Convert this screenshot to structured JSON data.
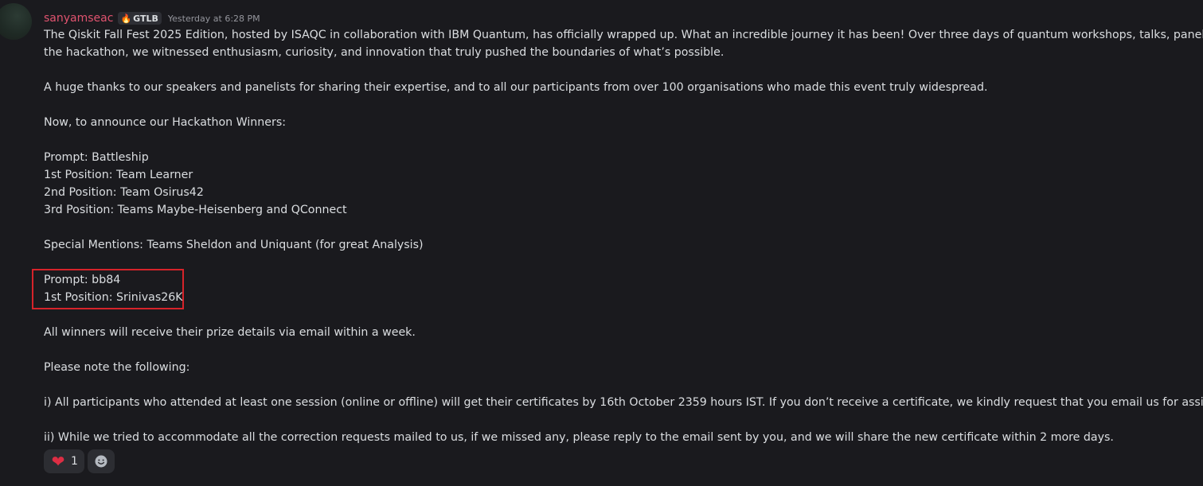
{
  "message": {
    "author": "sanyamseac",
    "tag": {
      "icon": "fire-icon",
      "label": "GTLB"
    },
    "timestamp": "Yesterday at 6:28 PM",
    "lines": [
      "The Qiskit Fall Fest 2025 Edition, hosted by ISAQC in collaboration with IBM Quantum, has officially wrapped up. What an incredible journey it has been! Over three days of quantum workshops, talks, panels, and",
      "the hackathon, we witnessed enthusiasm, curiosity, and innovation that truly pushed the boundaries of what’s possible.",
      "",
      "A huge thanks to our speakers and panelists for sharing their expertise, and to all our participants from over 100 organisations who made this event truly widespread.",
      "",
      "Now, to announce our Hackathon Winners:",
      "",
      "Prompt: Battleship",
      "1st Position: Team Learner",
      "2nd Position: Team Osirus42",
      "3rd Position: Teams Maybe-Heisenberg and QConnect",
      "",
      "Special Mentions: Teams Sheldon and Uniquant (for great Analysis)",
      "",
      "Prompt: bb84",
      "1st Position: Srinivas26K",
      "",
      "All winners will receive their prize details via email within a week.",
      "",
      "Please note the following:",
      "",
      "i) All participants who attended at least one session (online or offline) will get their certificates by 16th October 2359 hours IST. If you don’t receive a certificate, we kindly request that you email us for assistance.",
      "",
      "ii) While we tried to accommodate all the correction requests mailed to us, if we missed any, please reply to the email sent by you, and we will share the new certificate within 2 more days."
    ],
    "highlight_color": "#d6232a"
  },
  "reactions": [
    {
      "emoji": "❤",
      "icon": "heart-icon",
      "count": "1"
    }
  ],
  "add_reaction": {
    "icon": "add-reaction-icon"
  },
  "colors": {
    "background": "#1a1a1e",
    "username": "#e0536f",
    "text": "#dbdee1",
    "timestamp": "#94959c"
  }
}
